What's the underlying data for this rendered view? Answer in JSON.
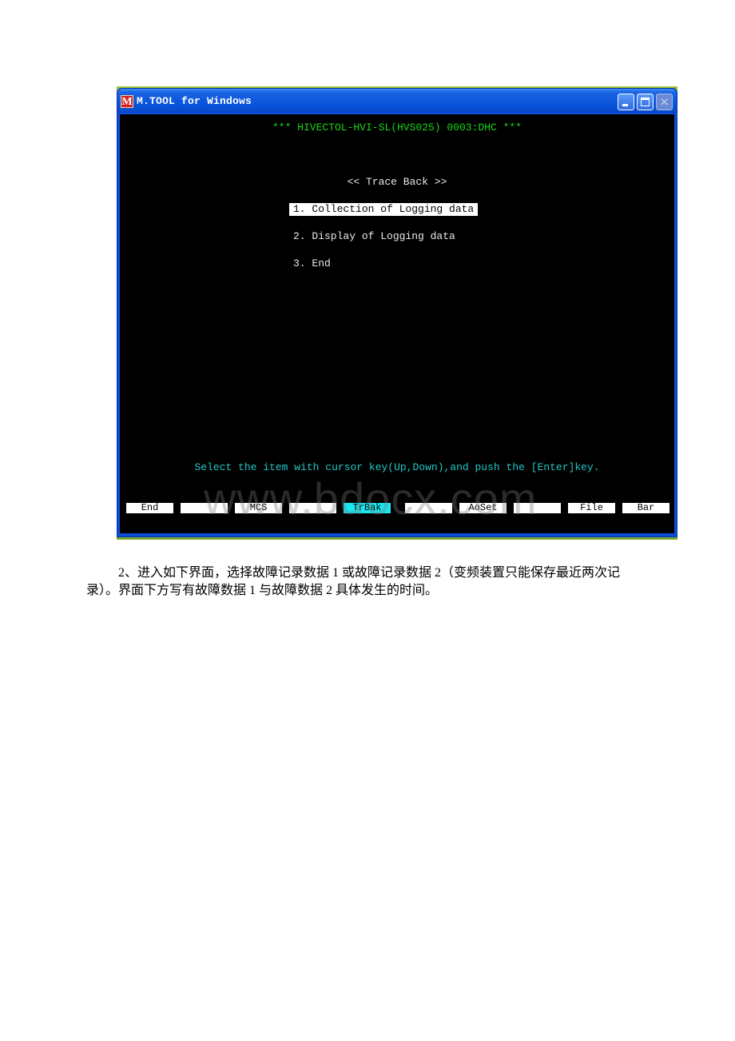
{
  "window": {
    "icon_letter": "M",
    "title": "M.TOOL for Windows",
    "controls": {
      "minimize": "minimize",
      "maximize": "maximize",
      "close": "×"
    }
  },
  "terminal": {
    "header": "*** HIVECTOL-HVI-SL(HVS025) 0003:DHC ***",
    "menu_title": "<< Trace Back >>",
    "menu_items": [
      {
        "label": "1. Collection of Logging data",
        "selected": true
      },
      {
        "label": "2. Display of Logging data",
        "selected": false
      },
      {
        "label": "3. End",
        "selected": false
      }
    ],
    "hint": "Select the item with cursor key(Up,Down),and push the [Enter]key.",
    "function_keys": [
      {
        "label": "End",
        "active": false
      },
      {
        "label": "",
        "active": false
      },
      {
        "label": "MCS",
        "active": false
      },
      {
        "label": "",
        "active": false
      },
      {
        "label": "TrBak",
        "active": true
      },
      {
        "label": "",
        "active": false
      },
      {
        "label": "AoSet",
        "active": false
      },
      {
        "label": "",
        "active": false
      },
      {
        "label": "File",
        "active": false
      },
      {
        "label": "Bar",
        "active": false
      }
    ],
    "colors": {
      "header": "#18d818",
      "hint": "#20c8c8",
      "active_key": "#18e8f0",
      "background": "#000000"
    }
  },
  "watermark": "www.bdocx.com",
  "document": {
    "paragraph": "2、进入如下界面，选择故障记录数据 1 或故障记录数据 2（变频装置只能保存最近两次记录）。界面下方写有故障数据 1 与故障数据 2 具体发生的时间。"
  }
}
